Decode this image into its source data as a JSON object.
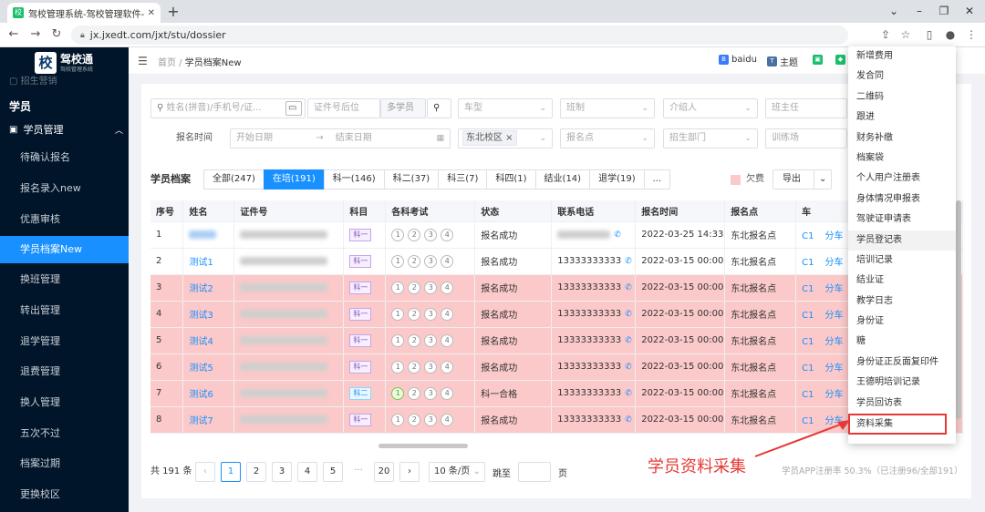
{
  "browser": {
    "tab_title": "驾校管理系统-驾校管理软件-驾...",
    "url": "jx.jxedt.com/jxt/stu/dossier"
  },
  "sidebar": {
    "brand": "驾校通",
    "brand_sub": "驾校管理系统",
    "ghost": "招生营销",
    "section": "学员",
    "group": "学员管理",
    "items": [
      "待确认报名",
      "报名录入new",
      "优惠审核",
      "学员档案New",
      "换班管理",
      "转出管理",
      "退学管理",
      "退费管理",
      "换人管理",
      "五次不过",
      "档案过期",
      "更换校区"
    ]
  },
  "header": {
    "home": "首页",
    "page": "学员档案New",
    "baidu": "baidu",
    "theme": "主题"
  },
  "filters": {
    "search_placeholder": "姓名(拼音)/手机号/证...",
    "id_placeholder": "证件号后位",
    "multi": "多学员",
    "car_type": "车型",
    "class_type": "班制",
    "introducer": "介绍人",
    "class_teacher": "班主任",
    "reg_time_label": "报名时间",
    "start_date": "开始日期",
    "end_date": "结束日期",
    "campus": "东北校区",
    "reg_point": "报名点",
    "recruit_dept": "招生部门",
    "training_field": "训练场"
  },
  "records": {
    "title": "学员档案",
    "tabs": [
      "全部(247)",
      "在培(191)",
      "科一(146)",
      "科二(37)",
      "科三(7)",
      "科四(1)",
      "结业(14)",
      "退学(19)",
      "..."
    ],
    "owe": "欠费",
    "export": "导出"
  },
  "table": {
    "headers": [
      "序号",
      "姓名",
      "证件号",
      "科目",
      "各科考试",
      "状态",
      "联系电话",
      "报名时间",
      "报名点",
      "车"
    ],
    "rows": [
      {
        "no": "1",
        "name": "",
        "subject": "科一",
        "status": "报名成功",
        "phone": "",
        "time": "2022-03-25 14:33",
        "point": "东北报名点",
        "car": "C1",
        "pink": false,
        "passed": false
      },
      {
        "no": "2",
        "name": "测试1",
        "subject": "科一",
        "status": "报名成功",
        "phone": "13333333333",
        "time": "2022-03-15 00:00",
        "point": "东北报名点",
        "car": "C1",
        "pink": false,
        "passed": false
      },
      {
        "no": "3",
        "name": "测试2",
        "subject": "科一",
        "status": "报名成功",
        "phone": "13333333333",
        "time": "2022-03-15 00:00",
        "point": "东北报名点",
        "car": "C1",
        "pink": true,
        "passed": false
      },
      {
        "no": "4",
        "name": "测试3",
        "subject": "科一",
        "status": "报名成功",
        "phone": "13333333333",
        "time": "2022-03-15 00:00",
        "point": "东北报名点",
        "car": "C1",
        "pink": true,
        "passed": false
      },
      {
        "no": "5",
        "name": "测试4",
        "subject": "科一",
        "status": "报名成功",
        "phone": "13333333333",
        "time": "2022-03-15 00:00",
        "point": "东北报名点",
        "car": "C1",
        "pink": true,
        "passed": false
      },
      {
        "no": "6",
        "name": "测试5",
        "subject": "科一",
        "status": "报名成功",
        "phone": "13333333333",
        "time": "2022-03-15 00:00",
        "point": "东北报名点",
        "car": "C1",
        "pink": true,
        "passed": false
      },
      {
        "no": "7",
        "name": "测试6",
        "subject": "科二",
        "status": "科一合格",
        "phone": "13333333333",
        "time": "2022-03-15 00:00",
        "point": "东北报名点",
        "car": "C1",
        "pink": true,
        "passed": true
      },
      {
        "no": "8",
        "name": "测试7",
        "subject": "科一",
        "status": "报名成功",
        "phone": "13333333333",
        "time": "2022-03-15 00:00",
        "point": "东北报名点",
        "car": "C1",
        "pink": true,
        "passed": false
      }
    ],
    "extra_col": "分车"
  },
  "pager": {
    "total": "共 191 条",
    "pages": [
      "1",
      "2",
      "3",
      "4",
      "5",
      "···",
      "20"
    ],
    "size": "10 条/页",
    "goto": "跳至",
    "page_unit": "页",
    "stats": "学员APP注册率 50.3%（已注册96/全部191）"
  },
  "menu": {
    "items": [
      "新增费用",
      "发合同",
      "二维码",
      "跟进",
      "财务补缴",
      "档案袋",
      "个人用户注册表",
      "身体情况申报表",
      "驾驶证申请表",
      "学员登记表",
      "培训记录",
      "结业证",
      "教学日志",
      "身份证",
      "糖",
      "身份证正反面复印件",
      "王德明培训记录",
      "学员回访表",
      "资料采集"
    ]
  },
  "annotation": "学员资料采集"
}
